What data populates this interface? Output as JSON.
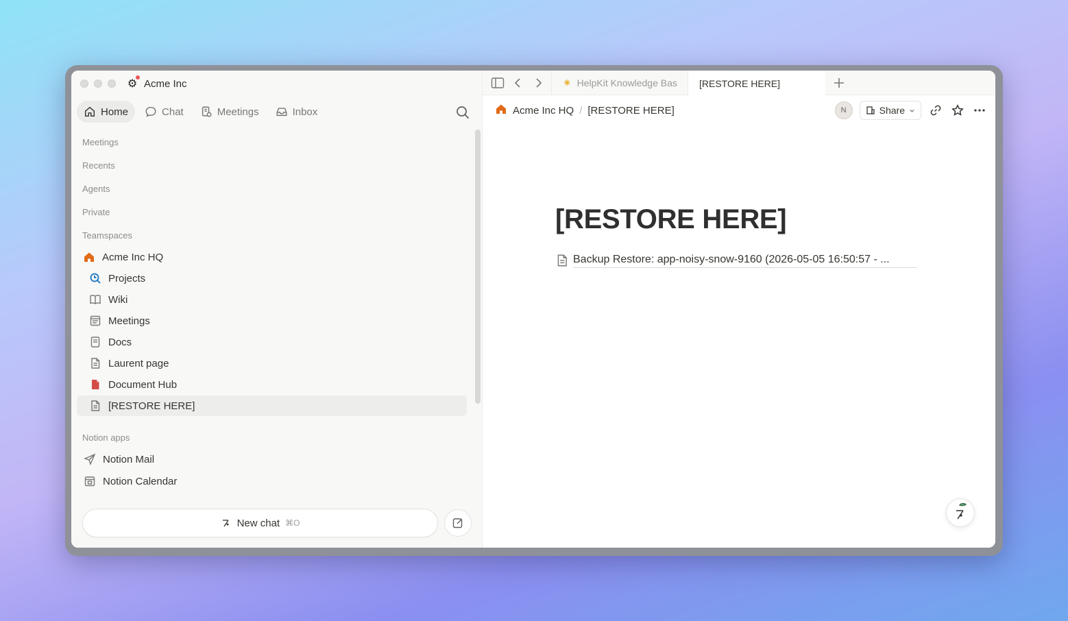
{
  "workspace": {
    "name": "Acme Inc"
  },
  "topnav": [
    {
      "label": "Home",
      "icon": "home-icon",
      "active": true
    },
    {
      "label": "Chat",
      "icon": "chat-icon"
    },
    {
      "label": "Meetings",
      "icon": "meetings-icon"
    },
    {
      "label": "Inbox",
      "icon": "inbox-icon"
    }
  ],
  "sidebar": {
    "sections": {
      "meetings": "Meetings",
      "recents": "Recents",
      "agents": "Agents",
      "private": "Private",
      "teamspaces": "Teamspaces",
      "notion_apps": "Notion apps"
    },
    "teamspace": {
      "label": "Acme Inc HQ",
      "icon": "house-icon",
      "color": "#e16b16"
    },
    "items": [
      {
        "label": "Projects",
        "icon": "projects-icon"
      },
      {
        "label": "Wiki",
        "icon": "book-icon"
      },
      {
        "label": "Meetings",
        "icon": "calendar-page-icon"
      },
      {
        "label": "Docs",
        "icon": "doc-icon"
      },
      {
        "label": "Laurent page",
        "icon": "page-icon"
      },
      {
        "label": "Document Hub",
        "icon": "document-hub-icon",
        "color": "#d44c47"
      },
      {
        "label": "[RESTORE HERE]",
        "icon": "page-icon",
        "active": true
      }
    ],
    "apps": [
      {
        "label": "Notion Mail",
        "icon": "mail-send-icon"
      },
      {
        "label": "Notion Calendar",
        "icon": "calendar-icon"
      }
    ],
    "new_chat": {
      "label": "New chat",
      "shortcut": "⌘O"
    }
  },
  "tabs": [
    {
      "label": "HelpKit Knowledge Bas",
      "icon": "sparkle-icon"
    },
    {
      "label": "[RESTORE HERE]",
      "active": true
    }
  ],
  "breadcrumb": {
    "teamspace": "Acme Inc HQ",
    "page": "[RESTORE HERE]"
  },
  "header": {
    "share_label": "Share",
    "avatar_initial": "N"
  },
  "page": {
    "title": "[RESTORE HERE]",
    "subpage": "Backup Restore: app-noisy-snow-9160 (2026-05-05 16:50:57 - ..."
  },
  "colors": {
    "accent": "#e16b16",
    "document_hub": "#d44c47",
    "projects": "#2f80c3"
  }
}
